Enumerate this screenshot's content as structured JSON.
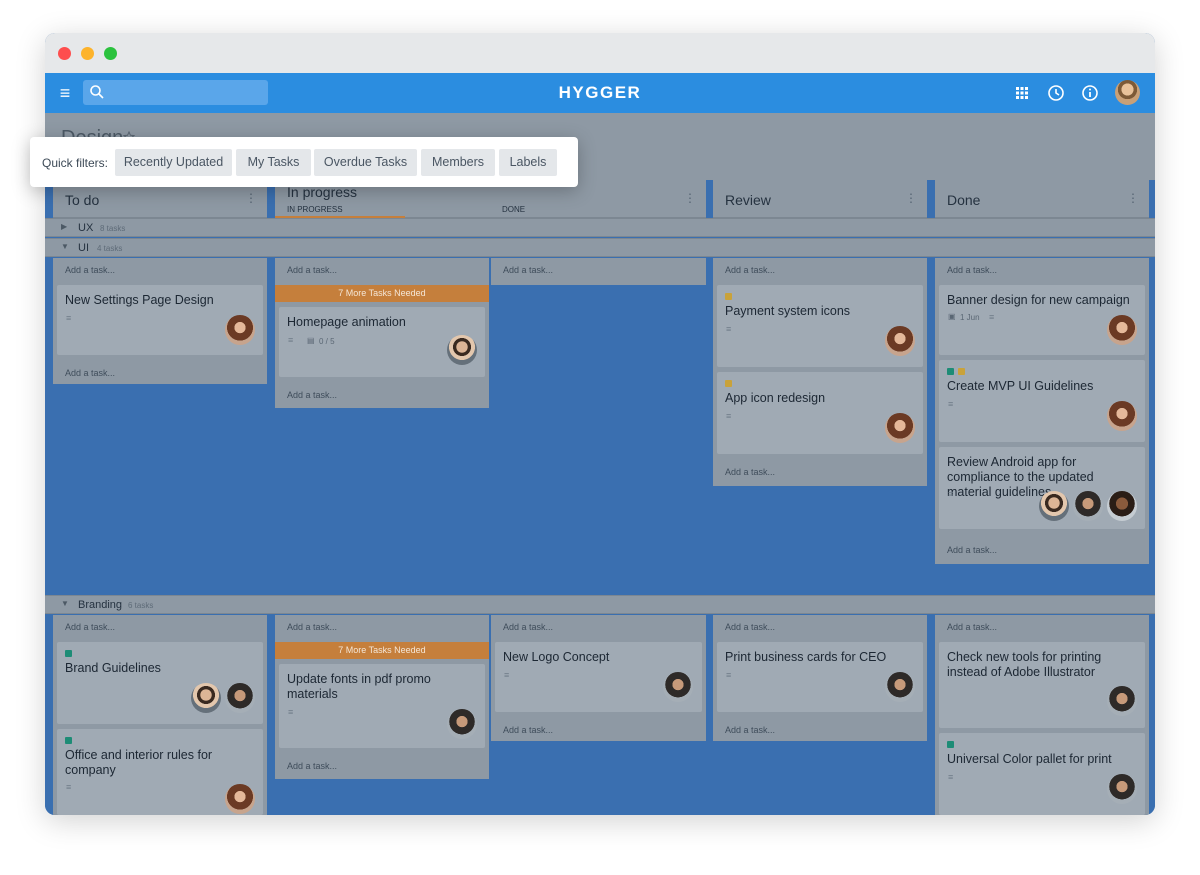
{
  "app": {
    "title": "HYGGER"
  },
  "board": {
    "title": "Design"
  },
  "columns": [
    {
      "title": "To do"
    },
    {
      "title": "In progress"
    },
    {
      "title": "Review"
    },
    {
      "title": "Done"
    }
  ],
  "subcolumns": {
    "in_progress": "IN PROGRESS",
    "done": "DONE"
  },
  "swimlanes": [
    {
      "name": "UX",
      "count": "8 tasks"
    },
    {
      "name": "UI",
      "count": "4 tasks"
    },
    {
      "name": "Branding",
      "count": "6 tasks"
    }
  ],
  "add_task": "Add a task...",
  "banner": "7 More Tasks Needed",
  "cards": {
    "settings": {
      "title": "New Settings Page Design"
    },
    "homepage": {
      "title": "Homepage animation",
      "checklist": "0 / 5"
    },
    "payment": {
      "title": "Payment system icons"
    },
    "appicon": {
      "title": "App icon redesign"
    },
    "banner": {
      "title": "Banner design for new campaign",
      "date": "1 Jun"
    },
    "mvp": {
      "title": "Create MVP UI Guidelines"
    },
    "android": {
      "title": "Review Android app for compliance to the updated material guidelines"
    },
    "brand": {
      "title": "Brand Guidelines"
    },
    "office": {
      "title": "Office and interior rules for company"
    },
    "fonts": {
      "title": "Update fonts in pdf promo materials"
    },
    "logo": {
      "title": "New Logo Concept"
    },
    "cards": {
      "title": "Print business cards for CEO"
    },
    "tools": {
      "title": "Check new tools for printing instead of Adobe Illustrator"
    },
    "palette": {
      "title": "Universal Color pallet for print"
    }
  },
  "quick_filters": {
    "label": "Quick filters:",
    "buttons": [
      "Recently Updated",
      "My Tasks",
      "Overdue Tasks",
      "Members",
      "Labels"
    ]
  },
  "colors": {
    "topbar": "#2b8de0",
    "board_bg": "#3a6fb0",
    "banner": "#c57f3c",
    "label_yellow": "#c9a23a",
    "label_green": "#1d8c76"
  },
  "icons": [
    "menu-icon",
    "search-icon",
    "apps-grid-icon",
    "clock-icon",
    "info-icon",
    "star-icon",
    "description-icon",
    "checklist-icon",
    "calendar-icon",
    "more-vert-icon"
  ]
}
